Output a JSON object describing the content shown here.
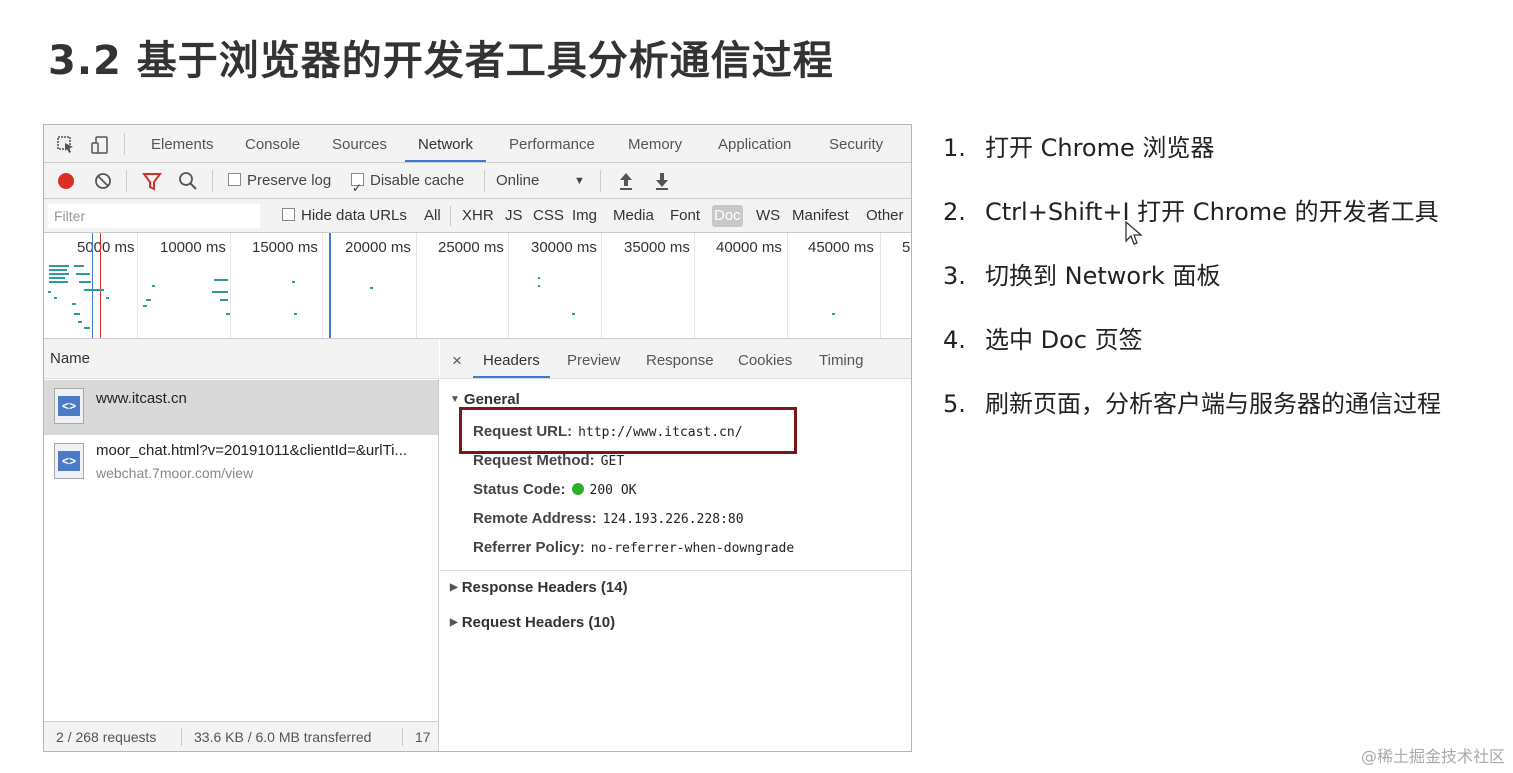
{
  "slide": {
    "title": "3.2 基于浏览器的开发者工具分析通信过程",
    "steps": [
      {
        "num": "1.",
        "text": "打开 Chrome 浏览器"
      },
      {
        "num": "2.",
        "text": "Ctrl+Shift+I 打开 Chrome 的开发者工具"
      },
      {
        "num": "3.",
        "text": "切换到 Network 面板"
      },
      {
        "num": "4.",
        "text": "选中 Doc 页签"
      },
      {
        "num": "5.",
        "text": "刷新页面，分析客户端与服务器的通信过程"
      }
    ],
    "watermark": "@稀土掘金技术社区"
  },
  "devtools": {
    "tabs": [
      "Elements",
      "Console",
      "Sources",
      "Network",
      "Performance",
      "Memory",
      "Application",
      "Security"
    ],
    "active_tab": "Network",
    "toolbar": {
      "preserve_log": "Preserve log",
      "disable_cache": "Disable cache",
      "throttle": "Online",
      "throttle_caret": "▼"
    },
    "filter": {
      "placeholder": "Filter",
      "hide_data_urls": "Hide data URLs",
      "types": [
        "All",
        "XHR",
        "JS",
        "CSS",
        "Img",
        "Media",
        "Font",
        "Doc",
        "WS",
        "Manifest",
        "Other"
      ],
      "selected_type": "Doc"
    },
    "timeline_ticks": [
      "5000 ms",
      "10000 ms",
      "15000 ms",
      "20000 ms",
      "25000 ms",
      "30000 ms",
      "35000 ms",
      "40000 ms",
      "45000 ms",
      "5"
    ],
    "name_header": "Name",
    "requests": [
      {
        "name": "www.itcast.cn",
        "sub": ""
      },
      {
        "name": "moor_chat.html?v=20191011&clientId=&urlTi...",
        "sub": "webchat.7moor.com/view"
      }
    ],
    "status": {
      "requests": "2 / 268 requests",
      "transferred": "33.6 KB / 6.0 MB transferred",
      "extra": "17"
    },
    "detail_tabs": [
      "Headers",
      "Preview",
      "Response",
      "Cookies",
      "Timing"
    ],
    "detail_close": "×",
    "general": {
      "title": "General",
      "request_url_label": "Request URL:",
      "request_url": "http://www.itcast.cn/",
      "method_label": "Request Method:",
      "method": "GET",
      "status_label": "Status Code:",
      "status": "200 OK",
      "remote_label": "Remote Address:",
      "remote": "124.193.226.228:80",
      "referrer_label": "Referrer Policy:",
      "referrer": "no-referrer-when-downgrade"
    },
    "response_headers": "Response Headers (14)",
    "request_headers": "Request Headers (10)"
  }
}
